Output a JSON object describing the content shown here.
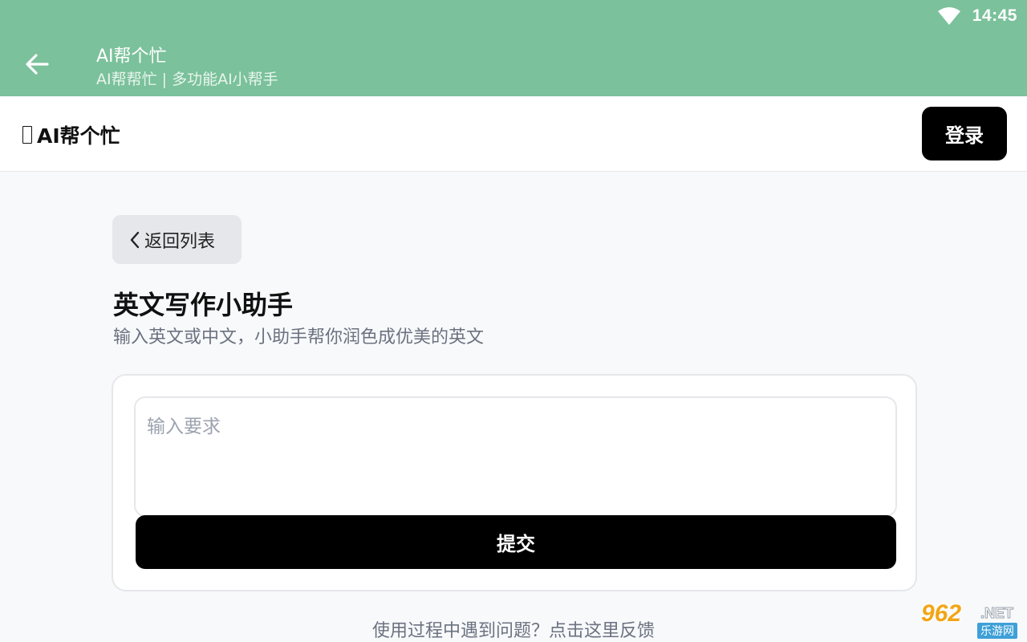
{
  "status_bar": {
    "time": "14:45",
    "wifi_icon": "wifi-icon"
  },
  "app_bar": {
    "back_icon": "arrow-left-icon",
    "title": "AI帮个忙",
    "subtitle": "AI帮帮忙 | 多功能AI小帮手",
    "color": "#7bc19b"
  },
  "header": {
    "brand_icon": "missing-glyph-icon",
    "brand": "AI帮个忙",
    "login_label": "登录"
  },
  "main": {
    "back_label": "返回列表",
    "back_icon": "chevron-left-icon",
    "title": "英文写作小助手",
    "description": "输入英文或中文，小助手帮你润色成优美的英文",
    "input": {
      "placeholder": "输入要求",
      "value": ""
    },
    "submit_label": "提交"
  },
  "footer": {
    "feedback": "使用过程中遇到问题？点击这里反馈"
  },
  "watermark": {
    "number": "962",
    "suffix": ".NET",
    "cn": "乐游网"
  }
}
